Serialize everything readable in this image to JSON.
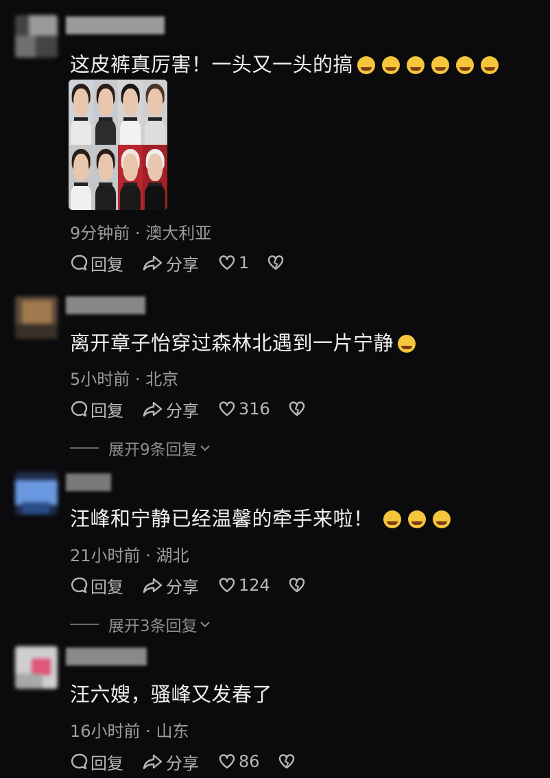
{
  "comments": [
    {
      "text": "这皮裤真厉害！一头又一头的搞",
      "emoji": [
        "laugh-cry",
        "laugh-cry",
        "laugh-cry",
        "laugh-cry",
        "laugh-cry",
        "laugh-cry"
      ],
      "has_image": true,
      "time": "9分钟前",
      "location": "澳大利亚",
      "reply_label": "回复",
      "share_label": "分享",
      "likes": "1"
    },
    {
      "text": "离开章子怡穿过森林北遇到一片宁静",
      "emoji": [
        "grin-sweat"
      ],
      "time": "5小时前",
      "location": "北京",
      "reply_label": "回复",
      "share_label": "分享",
      "likes": "316",
      "expand_label": "展开9条回复"
    },
    {
      "text": "汪峰和宁静已经温馨的牵手来啦！",
      "emoji": [
        "grin-sweat",
        "grin-sweat",
        "grin-sweat"
      ],
      "time": "21小时前",
      "location": "湖北",
      "reply_label": "回复",
      "share_label": "分享",
      "likes": "124",
      "expand_label": "展开3条回复"
    },
    {
      "text": "汪六嫂，骚峰又发春了",
      "emoji": [],
      "time": "16小时前",
      "location": "山东",
      "reply_label": "回复",
      "share_label": "分享",
      "likes": "86"
    }
  ],
  "separator": "·",
  "colors": {
    "background": "#0b0b0d",
    "text": "#f1f1f1",
    "meta": "#9d9d9d",
    "action": "#b8b8b8",
    "emoji": "#f5c63c"
  },
  "icons": [
    "comment-bubble-icon",
    "share-arrow-icon",
    "heart-icon",
    "broken-heart-icon",
    "chevron-down-icon"
  ]
}
